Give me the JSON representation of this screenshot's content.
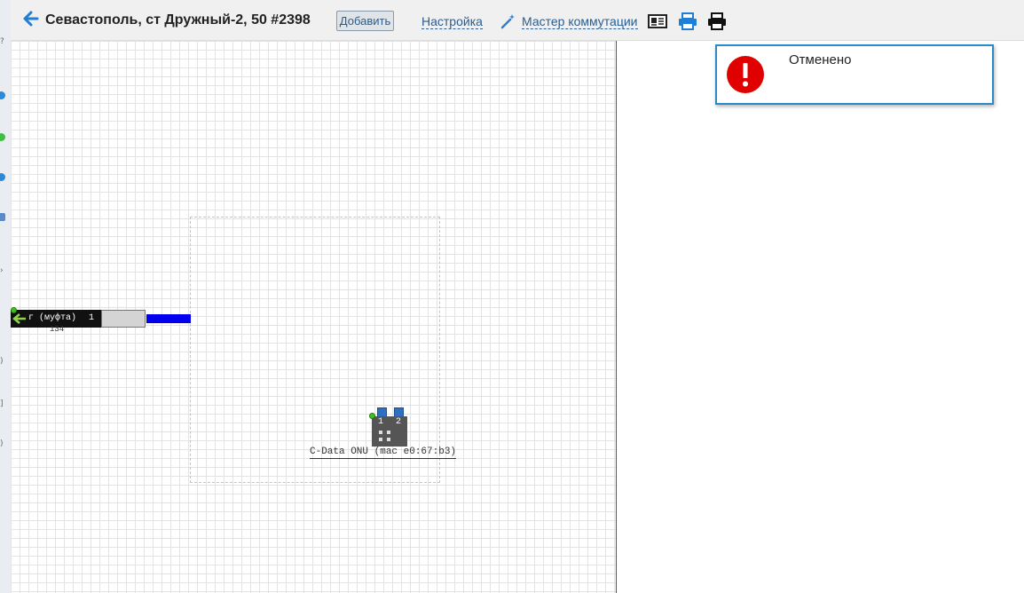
{
  "header": {
    "title": "Севастополь, ст Дружный-2, 50 #2398",
    "add_label": "Добавить",
    "settings_label": "Настройка",
    "wizard_label": "Мастер коммутации"
  },
  "scheme": {
    "cable_label": "г (муфта)",
    "cable_fiber_number": "1",
    "cable_sublabel": "134",
    "onu_ports": [
      "1",
      "2"
    ],
    "onu_label": "C-Data ONU (mac e0:67:b3)"
  },
  "notification": {
    "text": "Отменено"
  },
  "colors": {
    "accent": "#2a5d8f",
    "line": "#0000ee",
    "alert_border": "#2a8ac9",
    "error": "#e00000"
  },
  "icons": [
    "back-arrow-icon",
    "wand-icon",
    "card-icon",
    "printer-blue-icon",
    "printer-black-icon",
    "error-icon"
  ]
}
